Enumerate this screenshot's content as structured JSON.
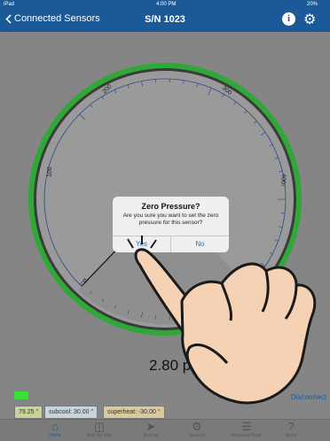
{
  "status_bar": {
    "device": "iPad",
    "time": "4:00 PM",
    "battery": "20%"
  },
  "nav": {
    "back_label": "Connected Sensors",
    "title": "S/N 1023",
    "info_icon": "info-icon",
    "settings_icon": "gear-icon"
  },
  "gauge": {
    "ticks": [
      {
        "label": "0"
      },
      {
        "label": "100"
      },
      {
        "label": "200"
      },
      {
        "label": "300"
      },
      {
        "label": "400"
      }
    ],
    "band_color": "#2fa838",
    "face_color": "#9a9a9a"
  },
  "reading": {
    "value": "2.80 p"
  },
  "info_row": {
    "temp": "79.25 °",
    "subcool": "subcool: 30.00 °",
    "superheat": "superheat: -30.00 °",
    "disconnect": "Disconnect"
  },
  "tabs": [
    {
      "label": "Home",
      "icon": "home-icon"
    },
    {
      "label": "Side By Side",
      "icon": "split-view-icon"
    },
    {
      "label": "Beat by",
      "icon": "arrow-icon"
    },
    {
      "label": "Sensors",
      "icon": "sensors-icon"
    },
    {
      "label": "Pressure/Temp",
      "icon": "list-icon"
    },
    {
      "label": "About",
      "icon": "help-icon"
    }
  ],
  "dialog": {
    "title": "Zero Pressure?",
    "message": "Are you sure you want to set the zero pressure for this sensor?",
    "yes": "Yes",
    "no": "No"
  },
  "colors": {
    "accent": "#1c5a97",
    "link": "#1c6fd0",
    "gauge_band": "#2fa838"
  }
}
